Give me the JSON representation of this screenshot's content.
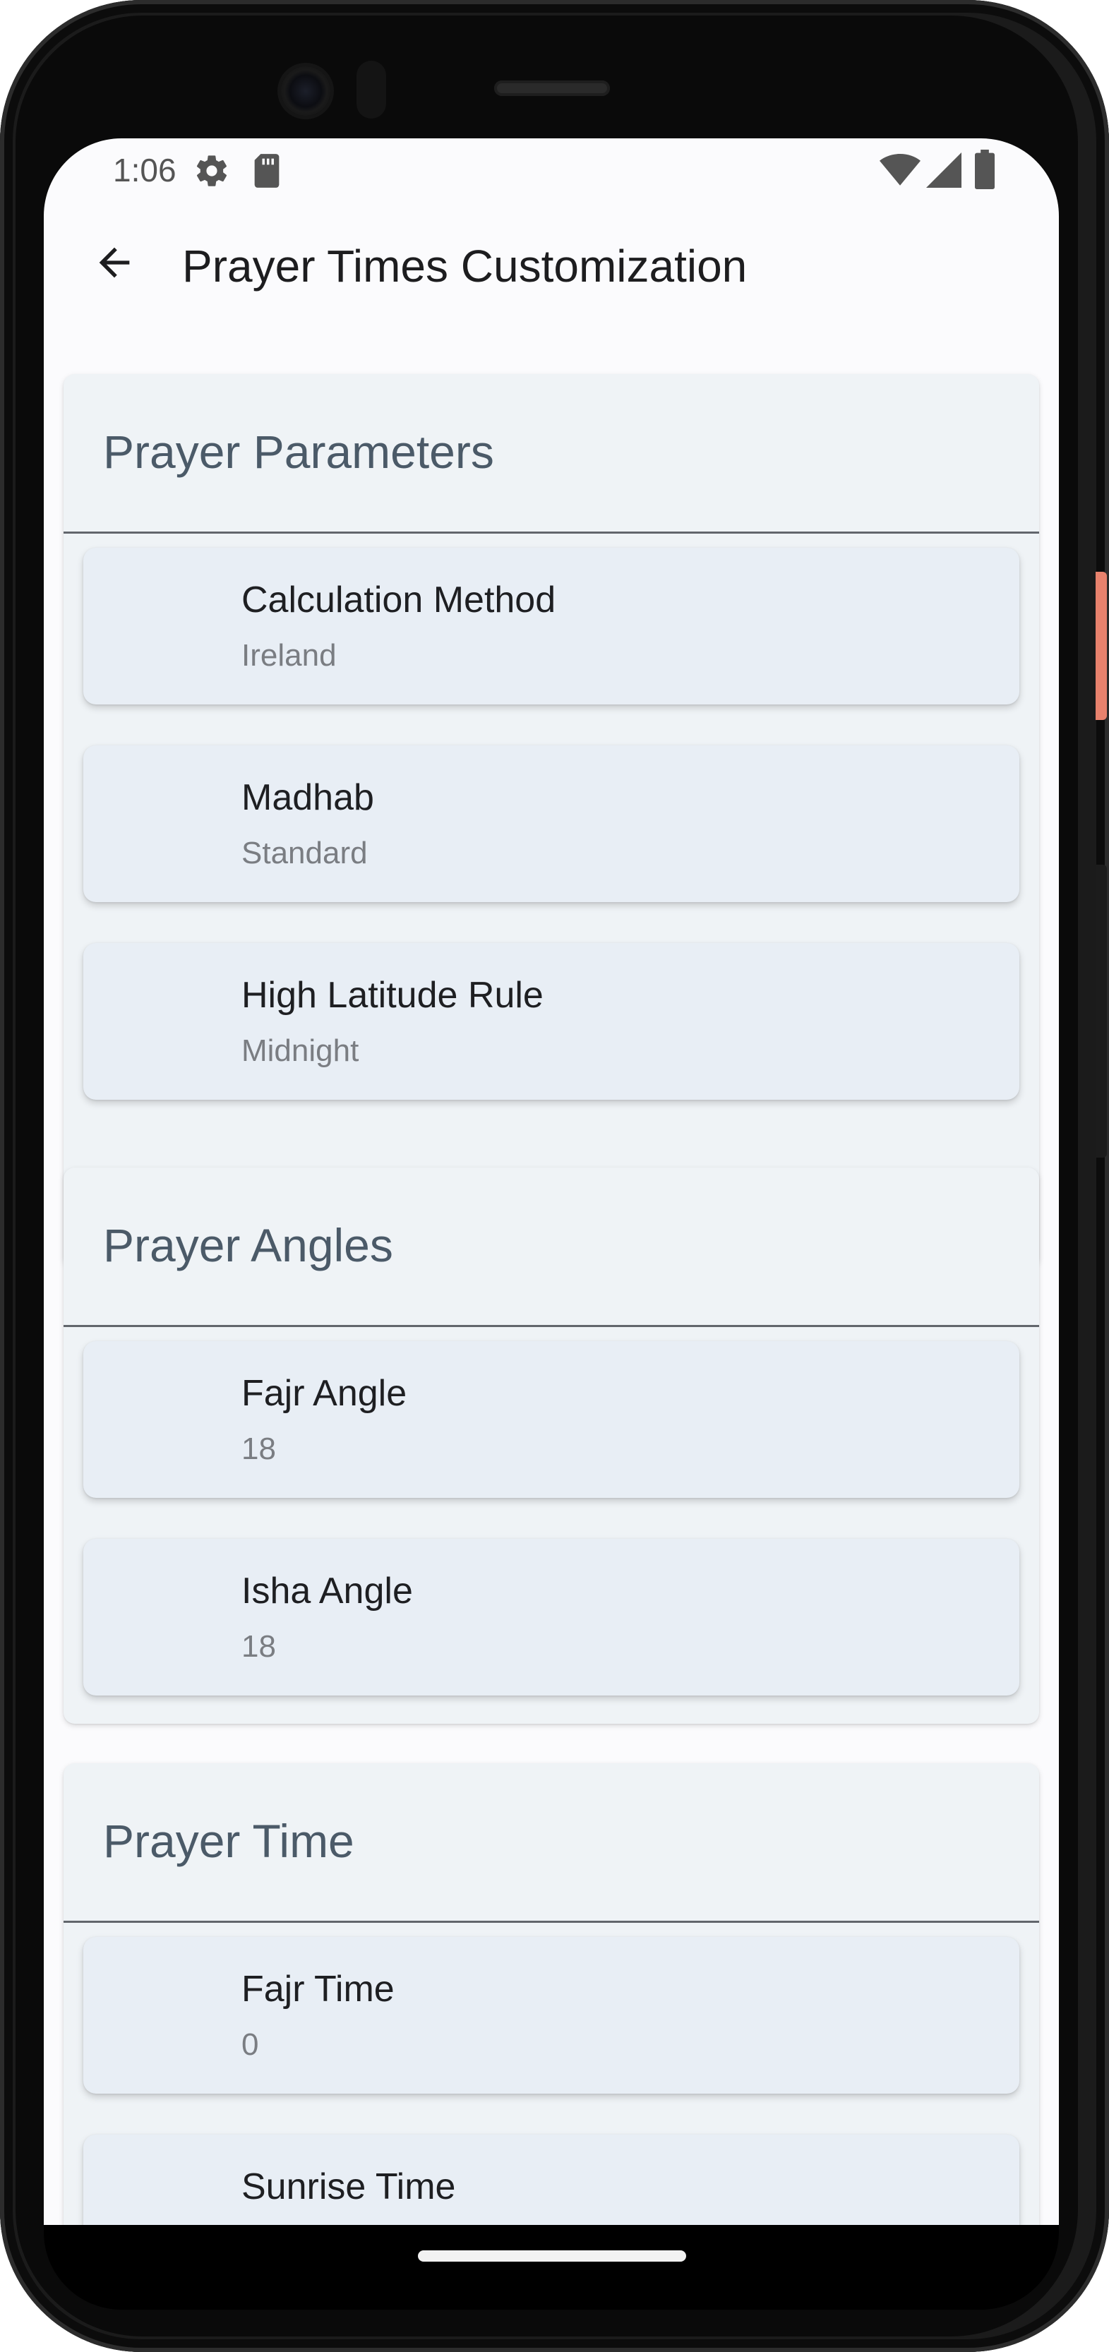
{
  "status_bar": {
    "time": "1:06",
    "left_icons": [
      "gear-icon",
      "sd-card-icon"
    ],
    "right_icons": [
      "wifi-icon",
      "signal-icon",
      "battery-icon"
    ]
  },
  "app_bar": {
    "title": "Prayer Times Customization",
    "back_icon": "arrow-back-icon"
  },
  "sections": [
    {
      "title": "Prayer Parameters",
      "items": [
        {
          "title": "Calculation Method",
          "value": "Ireland"
        },
        {
          "title": "Madhab",
          "value": "Standard"
        },
        {
          "title": "High Latitude Rule",
          "value": "Midnight"
        }
      ]
    },
    {
      "title": "Prayer Angles",
      "items": [
        {
          "title": "Fajr Angle",
          "value": "18"
        },
        {
          "title": "Isha Angle",
          "value": "18"
        }
      ]
    },
    {
      "title": "Prayer Time",
      "items": [
        {
          "title": "Fajr Time",
          "value": "0"
        },
        {
          "title": "Sunrise Time",
          "value": ""
        }
      ]
    }
  ],
  "colors": {
    "screen_background": "#fbfbfd",
    "section_background": "#eff3f6",
    "item_background": "#e8eef5",
    "section_title": "#4b5a68",
    "item_title": "#1e1f22",
    "item_value": "#7a7d82",
    "accent_side_button": "#e8826d"
  }
}
